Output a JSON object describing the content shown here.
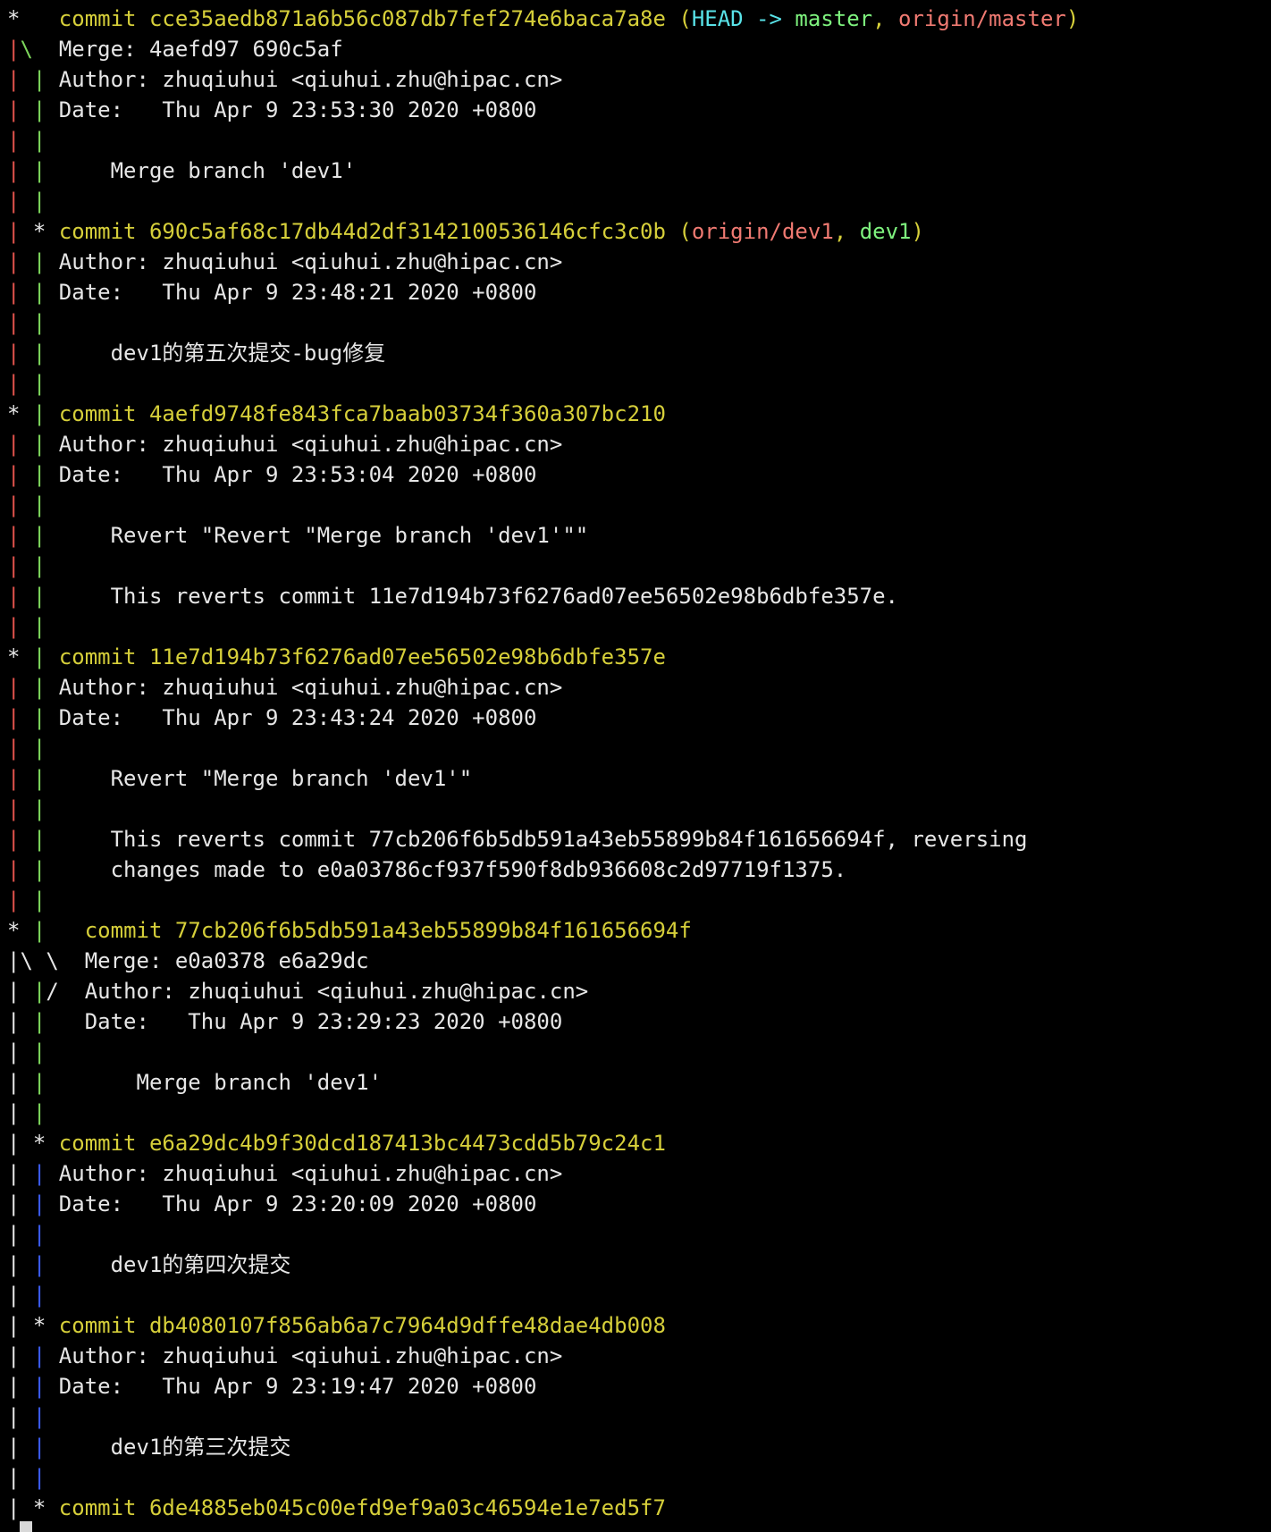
{
  "colors": {
    "default": "#e6e6e6",
    "commit": "#d6cf3a",
    "head": "#59e3e8",
    "local_branch": "#7ef27e",
    "remote_branch": "#f07a72",
    "graph_red": "#e0524c",
    "graph_green": "#7dd65c",
    "graph_blue": "#3b5cf0"
  },
  "lines": [
    [
      [
        "*   ",
        "default"
      ],
      [
        "commit cce35aedb871a6b56c087db7fef274e6baca7a8e (",
        "commit"
      ],
      [
        "HEAD -> ",
        "head"
      ],
      [
        "master",
        "local_branch"
      ],
      [
        ", ",
        "commit"
      ],
      [
        "origin/master",
        "remote_branch"
      ],
      [
        ")",
        "commit"
      ]
    ],
    [
      [
        "|",
        "graph_red"
      ],
      [
        "\\  ",
        "graph_green"
      ],
      [
        "Merge: 4aefd97 690c5af",
        "default"
      ]
    ],
    [
      [
        "|",
        "graph_red"
      ],
      [
        " ",
        "default"
      ],
      [
        "|",
        "graph_green"
      ],
      [
        " Author: zhuqiuhui <qiuhui.zhu@hipac.cn>",
        "default"
      ]
    ],
    [
      [
        "|",
        "graph_red"
      ],
      [
        " ",
        "default"
      ],
      [
        "|",
        "graph_green"
      ],
      [
        " Date:   Thu Apr 9 23:53:30 2020 +0800",
        "default"
      ]
    ],
    [
      [
        "|",
        "graph_red"
      ],
      [
        " ",
        "default"
      ],
      [
        "|",
        "graph_green"
      ]
    ],
    [
      [
        "|",
        "graph_red"
      ],
      [
        " ",
        "default"
      ],
      [
        "|",
        "graph_green"
      ],
      [
        "     Merge branch 'dev1'",
        "default"
      ]
    ],
    [
      [
        "|",
        "graph_red"
      ],
      [
        " ",
        "default"
      ],
      [
        "|",
        "graph_green"
      ]
    ],
    [
      [
        "|",
        "graph_red"
      ],
      [
        " * ",
        "default"
      ],
      [
        "commit 690c5af68c17db44d2df3142100536146cfc3c0b (",
        "commit"
      ],
      [
        "origin/dev1",
        "remote_branch"
      ],
      [
        ", ",
        "commit"
      ],
      [
        "dev1",
        "local_branch"
      ],
      [
        ")",
        "commit"
      ]
    ],
    [
      [
        "|",
        "graph_red"
      ],
      [
        " ",
        "default"
      ],
      [
        "|",
        "graph_green"
      ],
      [
        " Author: zhuqiuhui <qiuhui.zhu@hipac.cn>",
        "default"
      ]
    ],
    [
      [
        "|",
        "graph_red"
      ],
      [
        " ",
        "default"
      ],
      [
        "|",
        "graph_green"
      ],
      [
        " Date:   Thu Apr 9 23:48:21 2020 +0800",
        "default"
      ]
    ],
    [
      [
        "|",
        "graph_red"
      ],
      [
        " ",
        "default"
      ],
      [
        "|",
        "graph_green"
      ]
    ],
    [
      [
        "|",
        "graph_red"
      ],
      [
        " ",
        "default"
      ],
      [
        "|",
        "graph_green"
      ],
      [
        "     dev1的第五次提交-bug修复",
        "default"
      ]
    ],
    [
      [
        "|",
        "graph_red"
      ],
      [
        " ",
        "default"
      ],
      [
        "|",
        "graph_green"
      ]
    ],
    [
      [
        "* ",
        "default"
      ],
      [
        "|",
        "graph_green"
      ],
      [
        " ",
        "default"
      ],
      [
        "commit 4aefd9748fe843fca7baab03734f360a307bc210",
        "commit"
      ]
    ],
    [
      [
        "|",
        "graph_red"
      ],
      [
        " ",
        "default"
      ],
      [
        "|",
        "graph_green"
      ],
      [
        " Author: zhuqiuhui <qiuhui.zhu@hipac.cn>",
        "default"
      ]
    ],
    [
      [
        "|",
        "graph_red"
      ],
      [
        " ",
        "default"
      ],
      [
        "|",
        "graph_green"
      ],
      [
        " Date:   Thu Apr 9 23:53:04 2020 +0800",
        "default"
      ]
    ],
    [
      [
        "|",
        "graph_red"
      ],
      [
        " ",
        "default"
      ],
      [
        "|",
        "graph_green"
      ]
    ],
    [
      [
        "|",
        "graph_red"
      ],
      [
        " ",
        "default"
      ],
      [
        "|",
        "graph_green"
      ],
      [
        "     Revert \"Revert \"Merge branch 'dev1'\"\"",
        "default"
      ]
    ],
    [
      [
        "|",
        "graph_red"
      ],
      [
        " ",
        "default"
      ],
      [
        "|",
        "graph_green"
      ]
    ],
    [
      [
        "|",
        "graph_red"
      ],
      [
        " ",
        "default"
      ],
      [
        "|",
        "graph_green"
      ],
      [
        "     This reverts commit 11e7d194b73f6276ad07ee56502e98b6dbfe357e.",
        "default"
      ]
    ],
    [
      [
        "|",
        "graph_red"
      ],
      [
        " ",
        "default"
      ],
      [
        "|",
        "graph_green"
      ]
    ],
    [
      [
        "* ",
        "default"
      ],
      [
        "|",
        "graph_green"
      ],
      [
        " ",
        "default"
      ],
      [
        "commit 11e7d194b73f6276ad07ee56502e98b6dbfe357e",
        "commit"
      ]
    ],
    [
      [
        "|",
        "graph_red"
      ],
      [
        " ",
        "default"
      ],
      [
        "|",
        "graph_green"
      ],
      [
        " Author: zhuqiuhui <qiuhui.zhu@hipac.cn>",
        "default"
      ]
    ],
    [
      [
        "|",
        "graph_red"
      ],
      [
        " ",
        "default"
      ],
      [
        "|",
        "graph_green"
      ],
      [
        " Date:   Thu Apr 9 23:43:24 2020 +0800",
        "default"
      ]
    ],
    [
      [
        "|",
        "graph_red"
      ],
      [
        " ",
        "default"
      ],
      [
        "|",
        "graph_green"
      ]
    ],
    [
      [
        "|",
        "graph_red"
      ],
      [
        " ",
        "default"
      ],
      [
        "|",
        "graph_green"
      ],
      [
        "     Revert \"Merge branch 'dev1'\"",
        "default"
      ]
    ],
    [
      [
        "|",
        "graph_red"
      ],
      [
        " ",
        "default"
      ],
      [
        "|",
        "graph_green"
      ]
    ],
    [
      [
        "|",
        "graph_red"
      ],
      [
        " ",
        "default"
      ],
      [
        "|",
        "graph_green"
      ],
      [
        "     This reverts commit 77cb206f6b5db591a43eb55899b84f161656694f, reversing",
        "default"
      ]
    ],
    [
      [
        "|",
        "graph_red"
      ],
      [
        " ",
        "default"
      ],
      [
        "|",
        "graph_green"
      ],
      [
        "     changes made to e0a03786cf937f590f8db936608c2d97719f1375.",
        "default"
      ]
    ],
    [
      [
        "|",
        "graph_red"
      ],
      [
        " ",
        "default"
      ],
      [
        "|",
        "graph_green"
      ]
    ],
    [
      [
        "* ",
        "default"
      ],
      [
        "|",
        "graph_green"
      ],
      [
        "   ",
        "default"
      ],
      [
        "commit 77cb206f6b5db591a43eb55899b84f161656694f",
        "commit"
      ]
    ],
    [
      [
        "|\\ \\  ",
        "default"
      ],
      [
        "Merge: e0a0378 e6a29dc",
        "default"
      ]
    ],
    [
      [
        "| ",
        "default"
      ],
      [
        "|",
        "graph_green"
      ],
      [
        "/  ",
        "default"
      ],
      [
        "Author: zhuqiuhui <qiuhui.zhu@hipac.cn>",
        "default"
      ]
    ],
    [
      [
        "| ",
        "default"
      ],
      [
        "|",
        "graph_green"
      ],
      [
        "   Date:   Thu Apr 9 23:29:23 2020 +0800",
        "default"
      ]
    ],
    [
      [
        "| ",
        "default"
      ],
      [
        "|",
        "graph_green"
      ]
    ],
    [
      [
        "| ",
        "default"
      ],
      [
        "|",
        "graph_green"
      ],
      [
        "       Merge branch 'dev1'",
        "default"
      ]
    ],
    [
      [
        "| ",
        "default"
      ],
      [
        "|",
        "graph_green"
      ]
    ],
    [
      [
        "| * ",
        "default"
      ],
      [
        "commit e6a29dc4b9f30dcd187413bc4473cdd5b79c24c1",
        "commit"
      ]
    ],
    [
      [
        "| ",
        "default"
      ],
      [
        "|",
        "graph_blue"
      ],
      [
        " Author: zhuqiuhui <qiuhui.zhu@hipac.cn>",
        "default"
      ]
    ],
    [
      [
        "| ",
        "default"
      ],
      [
        "|",
        "graph_blue"
      ],
      [
        " Date:   Thu Apr 9 23:20:09 2020 +0800",
        "default"
      ]
    ],
    [
      [
        "| ",
        "default"
      ],
      [
        "|",
        "graph_blue"
      ]
    ],
    [
      [
        "| ",
        "default"
      ],
      [
        "|",
        "graph_blue"
      ],
      [
        "     dev1的第四次提交",
        "default"
      ]
    ],
    [
      [
        "| ",
        "default"
      ],
      [
        "|",
        "graph_blue"
      ]
    ],
    [
      [
        "| * ",
        "default"
      ],
      [
        "commit db4080107f856ab6a7c7964d9dffe48dae4db008",
        "commit"
      ]
    ],
    [
      [
        "| ",
        "default"
      ],
      [
        "|",
        "graph_blue"
      ],
      [
        " Author: zhuqiuhui <qiuhui.zhu@hipac.cn>",
        "default"
      ]
    ],
    [
      [
        "| ",
        "default"
      ],
      [
        "|",
        "graph_blue"
      ],
      [
        " Date:   Thu Apr 9 23:19:47 2020 +0800",
        "default"
      ]
    ],
    [
      [
        "| ",
        "default"
      ],
      [
        "|",
        "graph_blue"
      ]
    ],
    [
      [
        "| ",
        "default"
      ],
      [
        "|",
        "graph_blue"
      ],
      [
        "     dev1的第三次提交",
        "default"
      ]
    ],
    [
      [
        "| ",
        "default"
      ],
      [
        "|",
        "graph_blue"
      ]
    ],
    [
      [
        "| * ",
        "default"
      ],
      [
        "commit 6de4885eb045c00efd9ef9a03c46594e1e7ed5f7",
        "commit"
      ]
    ]
  ]
}
